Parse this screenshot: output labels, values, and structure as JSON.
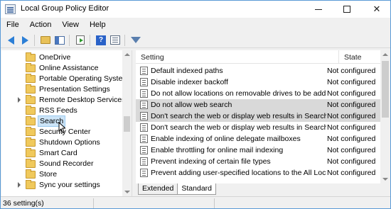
{
  "window": {
    "title": "Local Group Policy Editor"
  },
  "menu": [
    "File",
    "Action",
    "View",
    "Help"
  ],
  "tree": {
    "items": [
      {
        "label": "OneDrive",
        "has_children": false,
        "selected": false
      },
      {
        "label": "Online Assistance",
        "has_children": false,
        "selected": false
      },
      {
        "label": "Portable Operating System",
        "has_children": false,
        "selected": false
      },
      {
        "label": "Presentation Settings",
        "has_children": false,
        "selected": false
      },
      {
        "label": "Remote Desktop Services",
        "has_children": true,
        "selected": false
      },
      {
        "label": "RSS Feeds",
        "has_children": false,
        "selected": false
      },
      {
        "label": "Search",
        "has_children": false,
        "selected": true
      },
      {
        "label": "Security Center",
        "has_children": false,
        "selected": false
      },
      {
        "label": "Shutdown Options",
        "has_children": false,
        "selected": false
      },
      {
        "label": "Smart Card",
        "has_children": false,
        "selected": false
      },
      {
        "label": "Sound Recorder",
        "has_children": false,
        "selected": false
      },
      {
        "label": "Store",
        "has_children": false,
        "selected": false
      },
      {
        "label": "Sync your settings",
        "has_children": true,
        "selected": false
      }
    ]
  },
  "list": {
    "columns": {
      "setting": "Setting",
      "state": "State"
    },
    "rows": [
      {
        "setting": "Default indexed paths",
        "state": "Not configured",
        "highlighted": false
      },
      {
        "setting": "Disable indexer backoff",
        "state": "Not configured",
        "highlighted": false
      },
      {
        "setting": "Do not allow locations on removable drives to be add...",
        "state": "Not configured",
        "highlighted": false
      },
      {
        "setting": "Do not allow web search",
        "state": "Not configured",
        "highlighted": true
      },
      {
        "setting": "Don't search the web or display web results in Search",
        "state": "Not configured",
        "highlighted": true
      },
      {
        "setting": "Don't search the web or display web results in Search ...",
        "state": "Not configured",
        "highlighted": false
      },
      {
        "setting": "Enable indexing of online delegate mailboxes",
        "state": "Not configured",
        "highlighted": false
      },
      {
        "setting": "Enable throttling for online mail indexing",
        "state": "Not configured",
        "highlighted": false
      },
      {
        "setting": "Prevent indexing of certain file types",
        "state": "Not configured",
        "highlighted": false
      },
      {
        "setting": "Prevent adding user-specified locations to the All Loc...",
        "state": "Not configured",
        "highlighted": false
      }
    ]
  },
  "tabs": [
    "Extended",
    "Standard"
  ],
  "status": {
    "text": "36 setting(s)"
  },
  "icons": [
    "back-icon",
    "forward-icon",
    "up-folder-icon",
    "show-hide-tree-icon",
    "export-list-icon",
    "help-icon",
    "properties-icon",
    "filter-icon"
  ],
  "colors": {
    "selection": "#cce4f7",
    "highlight_row": "#d9d9d9",
    "accent": "#2c7fd6"
  }
}
